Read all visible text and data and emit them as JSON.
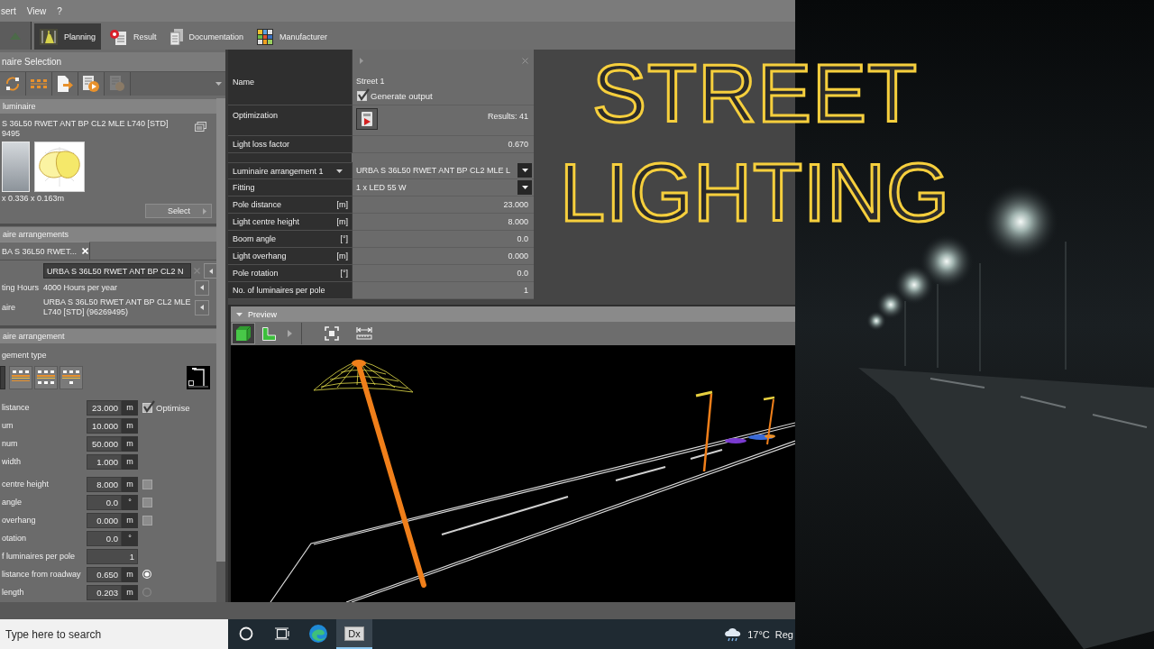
{
  "menu": [
    "sert",
    "View",
    "?"
  ],
  "ribbon_tabs": [
    {
      "kind": "planning",
      "label": "Planning",
      "selected": true
    },
    {
      "kind": "result",
      "label": "Result",
      "selected": false
    },
    {
      "kind": "documentation",
      "label": "Documentation",
      "selected": false
    },
    {
      "kind": "manufacturer",
      "label": "Manufacturer",
      "selected": false
    }
  ],
  "luminaire_panel": {
    "title": "naire Selection",
    "section": "luminaire",
    "name_lines": [
      "S 36L50 RWET ANT BP CL2 MLE L740 [STD]",
      "9495"
    ],
    "dimensions": "x 0.336 x 0.163m",
    "select_button": "Select"
  },
  "arrangements_panel": {
    "section": "aire arrangements",
    "tab": "BA S 36L50 RWET...",
    "name_field": "URBA S 36L50 RWET ANT BP CL2 N",
    "rows": [
      {
        "label": "ting Hours",
        "value": "4000 Hours per year"
      },
      {
        "label": "aire",
        "value": "URBA S 36L50 RWET ANT BP CL2 MLE L740 [STD] (96269495)"
      }
    ]
  },
  "arrangement_panel": {
    "section": "aire arrangement",
    "type_label": "gement type",
    "types": [
      {
        "selected": true
      },
      {
        "selected": false
      },
      {
        "selected": false
      },
      {
        "selected": false
      }
    ],
    "field_groups": [
      {
        "rows": [
          {
            "label": "listance",
            "value": "23.000",
            "unit": "m",
            "option": {
              "kind": "checkbox",
              "checked": true,
              "label": "Optimise"
            }
          },
          {
            "label": "um",
            "value": "10.000",
            "unit": "m"
          },
          {
            "label": "num",
            "value": "50.000",
            "unit": "m"
          },
          {
            "label": "width",
            "value": "1.000",
            "unit": "m"
          }
        ]
      },
      {
        "rows": [
          {
            "label": "centre height",
            "value": "8.000",
            "unit": "m",
            "option": {
              "kind": "checkbox",
              "checked": false
            }
          },
          {
            "label": "angle",
            "value": "0.0",
            "unit": "°",
            "option": {
              "kind": "checkbox",
              "checked": false
            }
          },
          {
            "label": "overhang",
            "value": "0.000",
            "unit": "m",
            "option": {
              "kind": "checkbox",
              "checked": false
            }
          },
          {
            "label": "otation",
            "value": "0.0",
            "unit": "°"
          },
          {
            "label": "f luminaires per pole",
            "value": "1"
          },
          {
            "label": "listance from roadway",
            "value": "0.650",
            "unit": "m",
            "option": {
              "kind": "radio",
              "selected": true
            }
          },
          {
            "label": "length",
            "value": "0.203",
            "unit": "m",
            "option": {
              "kind": "radio",
              "selected": false
            }
          }
        ]
      }
    ]
  },
  "properties": {
    "rows": [
      {
        "kind": "name",
        "label": "Name",
        "value": "Street 1",
        "checkbox": {
          "label": "Generate output",
          "checked": true
        }
      },
      {
        "kind": "optimization",
        "label": "Optimization",
        "value": "Results: 41"
      },
      {
        "kind": "number",
        "label": "Light loss factor",
        "value": "0.670"
      },
      {
        "kind": "arrangement",
        "label": "Luminaire arrangement 1",
        "value": "URBA S 36L50 RWET ANT BP CL2 MLE L"
      },
      {
        "kind": "dropdown",
        "label": "Fitting",
        "value": "1 x LED 55 W"
      },
      {
        "kind": "number",
        "label": "Pole distance",
        "unit": "[m]",
        "value": "23.000"
      },
      {
        "kind": "number",
        "label": "Light centre height",
        "unit": "[m]",
        "value": "8.000"
      },
      {
        "kind": "number",
        "label": "Boom angle",
        "unit": "[°]",
        "value": "0.0"
      },
      {
        "kind": "number",
        "label": "Light overhang",
        "unit": "[m]",
        "value": "0.000"
      },
      {
        "kind": "number",
        "label": "Pole rotation",
        "unit": "[°]",
        "value": "0.0"
      },
      {
        "kind": "number",
        "label": "No. of luminaires per pole",
        "value": "1"
      }
    ]
  },
  "preview": {
    "title": "Preview",
    "view_buttons": [
      {
        "kind": "perspective",
        "selected": true
      },
      {
        "kind": "plan",
        "selected": false
      }
    ]
  },
  "title": "STREET LIGHTING",
  "taskbar": {
    "search": {
      "placeholder": "Type here to search"
    },
    "apps": [
      {
        "kind": "browser",
        "selected": false
      },
      {
        "kind": "app",
        "label": "Dx",
        "selected": true
      }
    ],
    "temperature": "17°C",
    "weather_text": "Reg"
  }
}
